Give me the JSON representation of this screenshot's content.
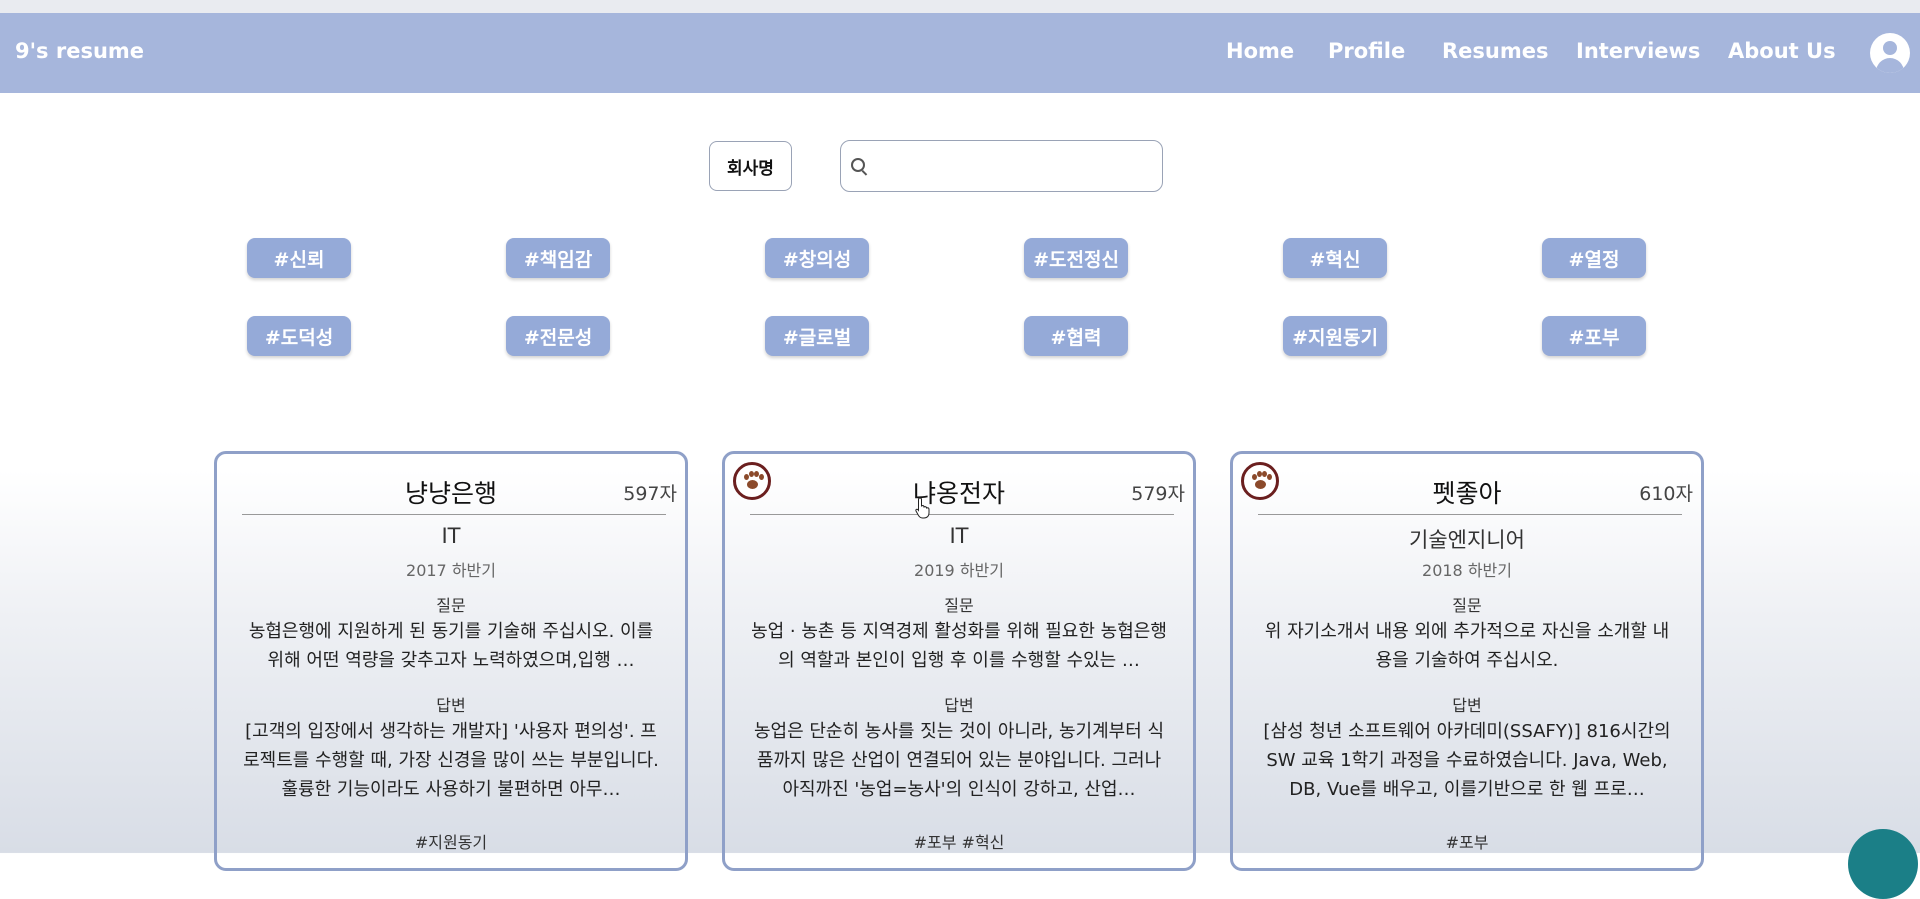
{
  "nav": {
    "brand": "9's resume",
    "links": [
      "Home",
      "Profile",
      "Resumes",
      "Interviews",
      "About Us"
    ],
    "profile_icon": "user-avatar-icon"
  },
  "search": {
    "company_button": "회사명",
    "placeholder": "",
    "icon": "search-icon"
  },
  "tags": [
    [
      "#신뢰",
      "#책임감",
      "#창의성",
      "#도전정신",
      "#혁신",
      "#열정"
    ],
    [
      "#도덕성",
      "#전문성",
      "#글로벌",
      "#협력",
      "#지원동기",
      "#포부"
    ]
  ],
  "cards": [
    {
      "title": "냥냥은행",
      "count": "597자",
      "category": "IT",
      "period": "2017 하반기",
      "question_label": "질문",
      "question": "농협은행에 지원하게 된 동기를 기술해 주십시오. 이를 위해 어떤 역량을 갖추고자 노력하였으며,입행 …",
      "answer_label": "답변",
      "answer": "[고객의 입장에서 생각하는 개발자] '사용자 편의성'. 프로젝트를 수행할 때, 가장 신경을 많이 쓰는 부분입니다. 훌륭한 기능이라도 사용하기 불편하면 아무…",
      "tags": "#지원동기",
      "has_icon": false
    },
    {
      "title": "냐옹전자",
      "count": "579자",
      "category": "IT",
      "period": "2019 하반기",
      "question_label": "질문",
      "question": "농업 · 농촌 등 지역경제 활성화를 위해 필요한 농협은행의 역할과 본인이 입행 후 이를 수행할 수있는 …",
      "answer_label": "답변",
      "answer": "농업은 단순히 농사를 짓는 것이 아니라, 농기계부터 식품까지 많은 산업이 연결되어 있는 분야입니다. 그러나 아직까진 '농업=농사'의 인식이 강하고, 산업…",
      "tags": "#포부 #혁신",
      "has_icon": true
    },
    {
      "title": "펫좋아",
      "count": "610자",
      "category": "기술엔지니어",
      "period": "2018 하반기",
      "question_label": "질문",
      "question": "위 자기소개서 내용 외에 추가적으로 자신을 소개할 내용을 기술하여 주십시오.",
      "answer_label": "답변",
      "answer": "[삼성 청년 소프트웨어 아카데미(SSAFY)] 816시간의 SW 교육 1학기 과정을 수료하였습니다. Java, Web, DB, Vue를 배우고, 이를기반으로 한 웹 프로…",
      "tags": "#포부",
      "has_icon": true
    }
  ],
  "colors": {
    "navbar": "#a6b6dc",
    "tag": "#95aad8",
    "card_border": "#8fa0c8",
    "paw_ring": "#6b1f1f",
    "fab": "#1b7f87"
  }
}
